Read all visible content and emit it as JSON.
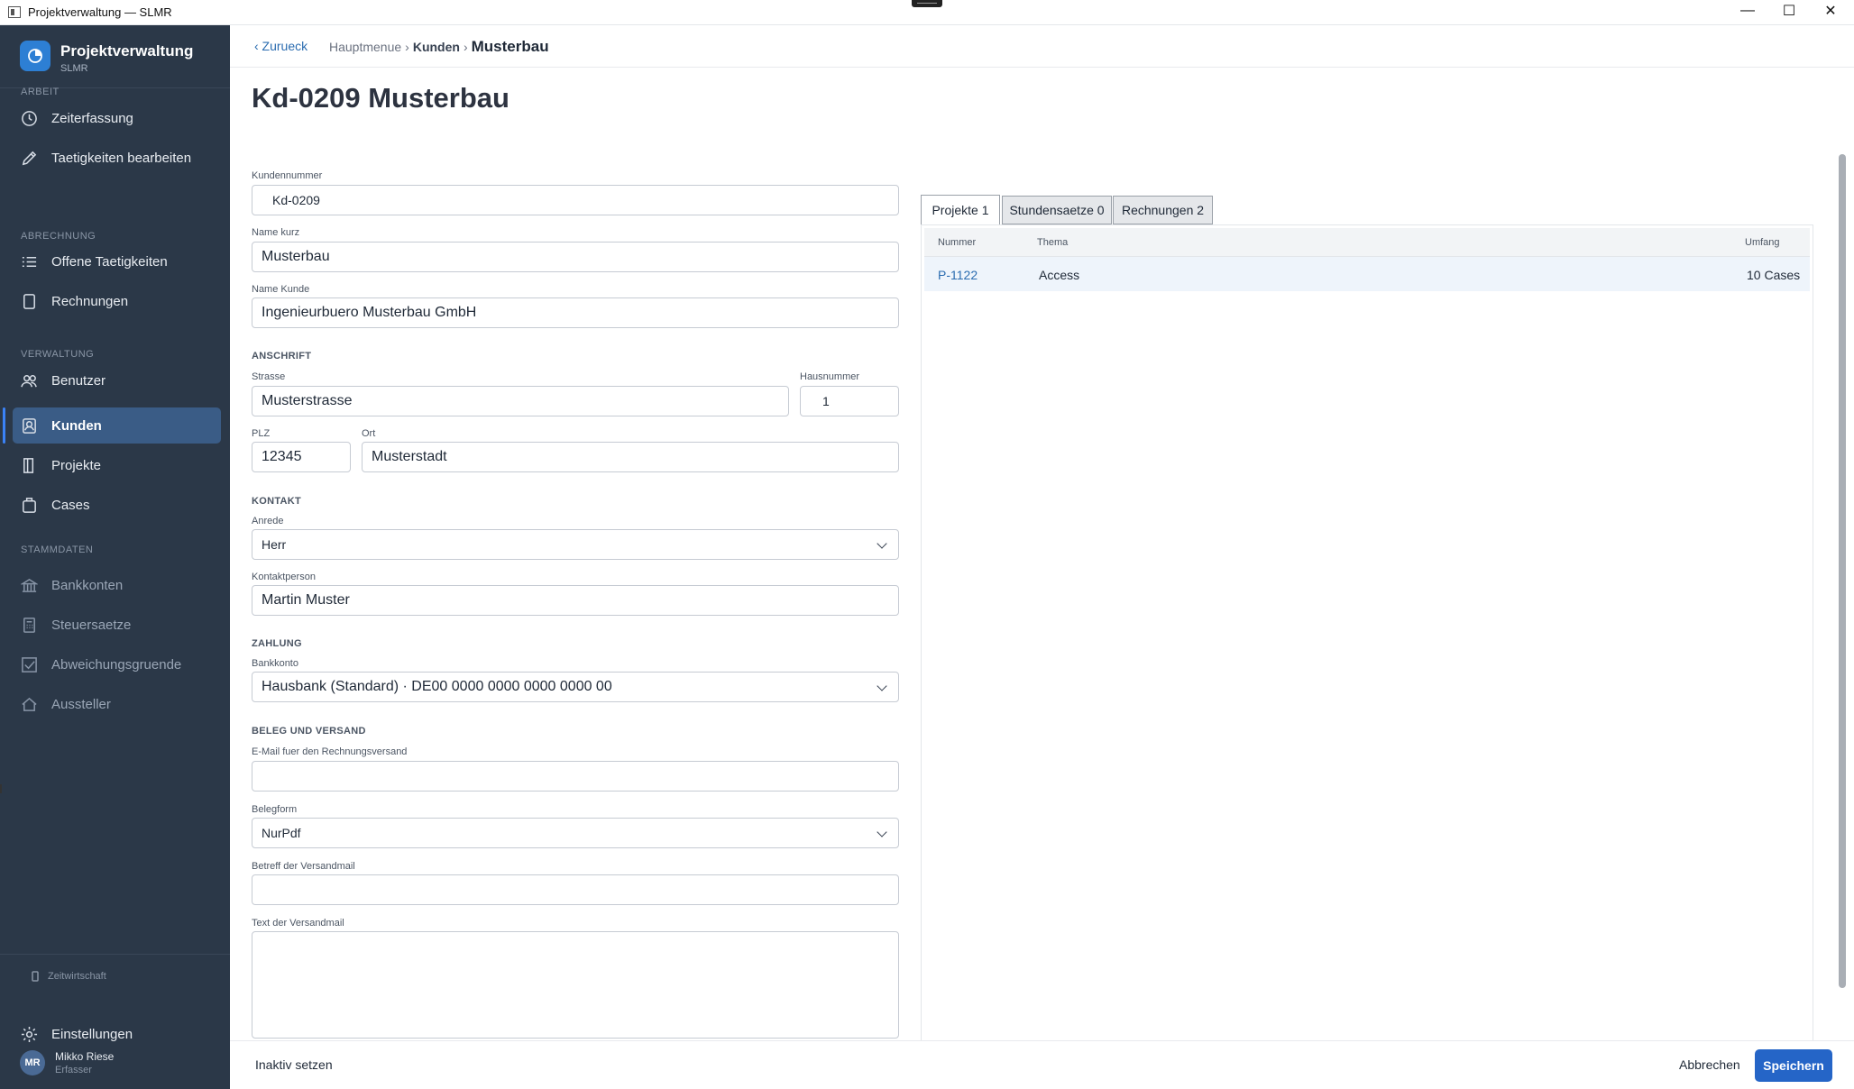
{
  "window": {
    "title": "Projektverwaltung — SLMR",
    "min_glyph": "—",
    "max_glyph": "☐",
    "close_glyph": "✕"
  },
  "sidebar": {
    "app_name": "Projektverwaltung",
    "app_sub": "SLMR",
    "sections": {
      "arbeit": "ARBEIT",
      "abrechnung": "ABRECHNUNG",
      "verwaltung": "VERWALTUNG",
      "stammdaten": "STAMMDATEN"
    },
    "items": [
      {
        "label": "Zeiterfassung",
        "icon": "clock-icon"
      },
      {
        "label": "Taetigkeiten bearbeiten",
        "icon": "pencil-icon"
      },
      {
        "label": "Offene Taetigkeiten",
        "icon": "list-icon"
      },
      {
        "label": "Rechnungen",
        "icon": "document-icon"
      },
      {
        "label": "Benutzer",
        "icon": "users-icon"
      },
      {
        "label": "Kunden",
        "icon": "contact-icon"
      },
      {
        "label": "Projekte",
        "icon": "book-icon"
      },
      {
        "label": "Cases",
        "icon": "clipboard-icon"
      },
      {
        "label": "Bankkonten",
        "icon": "bank-icon"
      },
      {
        "label": "Steuersaetze",
        "icon": "calculator-icon"
      },
      {
        "label": "Abweichungsgruende",
        "icon": "checkbox-icon"
      },
      {
        "label": "Aussteller",
        "icon": "home-icon"
      }
    ],
    "footer_small": "Zeitwirtschaft",
    "settings_label": "Einstellungen",
    "user": {
      "initials": "MR",
      "name": "Mikko Riese",
      "role": "Erfasser"
    }
  },
  "header": {
    "back_label": "‹ Zurueck",
    "breadcrumb": {
      "root": "Hauptmenue",
      "sep": "›",
      "parent": "Kunden",
      "current": "Musterbau"
    }
  },
  "page": {
    "title": "Kd-0209 Musterbau"
  },
  "form": {
    "kundennummer": {
      "label": "Kundennummer",
      "value": "Kd-0209"
    },
    "name_kurz": {
      "label": "Name kurz",
      "value": "Musterbau"
    },
    "name_kunde": {
      "label": "Name Kunde",
      "value": "Ingenieurbuero Musterbau GmbH"
    },
    "anschrift_label": "ANSCHRIFT",
    "strasse": {
      "label": "Strasse",
      "value": "Musterstrasse"
    },
    "hausnummer": {
      "label": "Hausnummer",
      "value": "1"
    },
    "plz": {
      "label": "PLZ",
      "value": "12345"
    },
    "ort": {
      "label": "Ort",
      "value": "Musterstadt"
    },
    "kontakt_label": "KONTAKT",
    "anrede": {
      "label": "Anrede",
      "value": "Herr"
    },
    "kontaktperson": {
      "label": "Kontaktperson",
      "value": "Martin Muster"
    },
    "zahlung_label": "ZAHLUNG",
    "bankkonto": {
      "label": "Bankkonto",
      "value": "Hausbank (Standard) · DE00 0000 0000 0000 0000 00"
    },
    "beleg_label": "BELEG UND VERSAND",
    "email": {
      "label": "E-Mail fuer den Rechnungsversand",
      "value": ""
    },
    "belegform": {
      "label": "Belegform",
      "value": "NurPdf"
    },
    "betreff": {
      "label": "Betreff der Versandmail",
      "value": ""
    },
    "text": {
      "label": "Text der Versandmail",
      "value": ""
    }
  },
  "tabs": [
    {
      "label": "Projekte 1",
      "active": true
    },
    {
      "label": "Stundensaetze 0",
      "active": false
    },
    {
      "label": "Rechnungen 2",
      "active": false
    }
  ],
  "projects_table": {
    "columns": [
      "Nummer",
      "Thema",
      "Umfang"
    ],
    "rows": [
      [
        "P-1122",
        "Access",
        "10 Cases"
      ]
    ]
  },
  "footer": {
    "inactive_label": "Inaktiv setzen",
    "cancel_label": "Abbrechen",
    "save_label": "Speichern"
  },
  "colors": {
    "sidebar_bg": "#2b3848",
    "active_item": "#3a5c86",
    "accent": "#2565c7",
    "link": "#2b6cb0"
  }
}
